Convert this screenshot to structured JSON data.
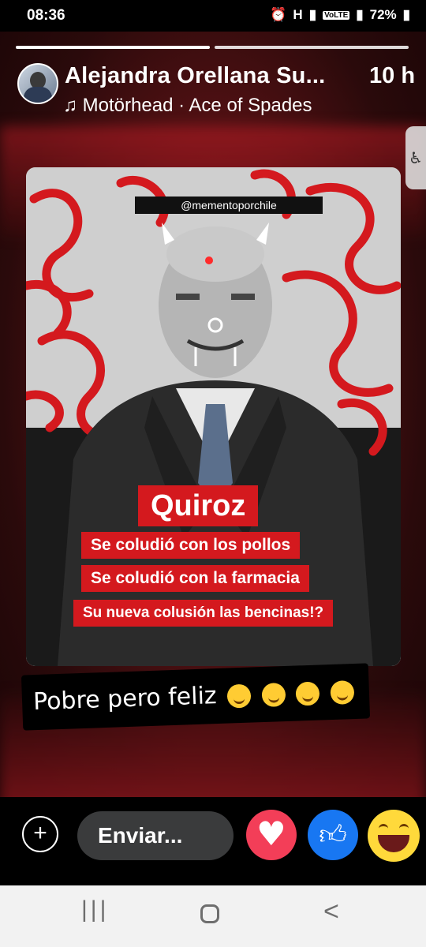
{
  "status": {
    "time": "08:36",
    "network": "H",
    "network2": "VoLTE",
    "battery": "72%"
  },
  "story": {
    "author": "Alejandra Orellana Su...",
    "time_ago": "10 h",
    "music": "Motörhead · Ace of Spades",
    "music_icon": "♫"
  },
  "poster": {
    "handle": "@mementoporchile",
    "name": "Quiroz",
    "line1": "Se coludió con los pollos",
    "line2": "Se coludió con la farmacia",
    "line3": "Su nueva colusión las bencinas!?"
  },
  "caption": {
    "text": "Pobre pero feliz"
  },
  "bottom": {
    "send_label": "Enviar...",
    "add_icon": "+"
  },
  "colors": {
    "poster_red": "#d4191e",
    "heart": "#f33e58",
    "like": "#1877f2",
    "haha": "#ffd93b"
  }
}
